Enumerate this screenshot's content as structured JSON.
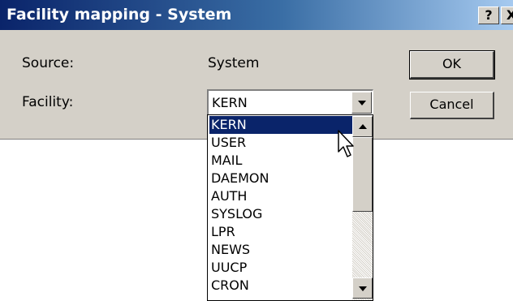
{
  "window": {
    "title": "Facility mapping - System",
    "help_label": "?",
    "close_label": "X"
  },
  "form": {
    "source_label": "Source:",
    "source_value": "System",
    "facility_label": "Facility:",
    "facility_value": "KERN"
  },
  "buttons": {
    "ok": "OK",
    "cancel": "Cancel"
  },
  "dropdown": {
    "selected": "KERN",
    "items": [
      "KERN",
      "USER",
      "MAIL",
      "DAEMON",
      "AUTH",
      "SYSLOG",
      "LPR",
      "NEWS",
      "UUCP",
      "CRON"
    ]
  },
  "colors": {
    "selection": "#0a246a",
    "dialog_face": "#d4d0c8"
  },
  "icons": {
    "cursor": "arrow-pointer-icon",
    "dropdown": "chevron-down-icon"
  }
}
